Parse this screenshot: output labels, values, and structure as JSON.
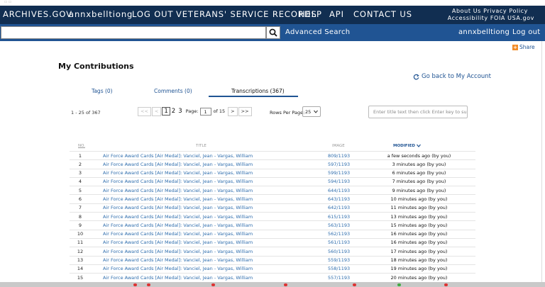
{
  "topnav": {
    "brand": "ARCHIVES.GOV",
    "username": "annxbelltiong",
    "logout": "LOG OUT",
    "veterans": "VETERANS' SERVICE RECORDS",
    "help": "HELP",
    "api": "API",
    "contact": "CONTACT US",
    "util_row1": "About Us  Privacy Policy",
    "util_row2": "Accessibility  FOIA  USA.gov"
  },
  "searchbar": {
    "query": "",
    "placeholder": "",
    "advanced": "Advanced Search",
    "username": "annxbelltiong",
    "logout": "Log out"
  },
  "share": "Share",
  "page_title": "My Contributions",
  "go_back": "Go back to My Account",
  "tabs": [
    {
      "label": "Tags (0)"
    },
    {
      "label": "Comments (0)"
    },
    {
      "label": "Transcriptions (367)"
    }
  ],
  "pagination": {
    "range": "1 - 25 of 367",
    "first": "<<",
    "prev": "<",
    "pages": [
      "1",
      "2",
      "3"
    ],
    "page_label": "Page:",
    "page_value": "1",
    "of": "of 15",
    "next": ">",
    "last": ">>"
  },
  "rows_per_page": {
    "label": "Rows Per Page:",
    "value": "25"
  },
  "filter": {
    "placeholder": "Enter title text then click Enter key to sub"
  },
  "table": {
    "headers": {
      "no": "NO.",
      "title": "TITLE",
      "image": "IMAGE",
      "modified": "MODIFIED"
    },
    "rows": [
      {
        "no": "1",
        "title": "Air Force Award Cards [Air Medal]: Vanciel, Jean - Vargas, William",
        "image": "809/1193",
        "modified": "a few seconds ago (by you)"
      },
      {
        "no": "2",
        "title": "Air Force Award Cards [Air Medal]: Vanciel, Jean - Vargas, William",
        "image": "597/1193",
        "modified": "3 minutes ago (by you)"
      },
      {
        "no": "3",
        "title": "Air Force Award Cards [Air Medal]: Vanciel, Jean - Vargas, William",
        "image": "599/1193",
        "modified": "6 minutes ago (by you)"
      },
      {
        "no": "4",
        "title": "Air Force Award Cards [Air Medal]: Vanciel, Jean - Vargas, William",
        "image": "594/1193",
        "modified": "7 minutes ago (by you)"
      },
      {
        "no": "5",
        "title": "Air Force Award Cards [Air Medal]: Vanciel, Jean - Vargas, William",
        "image": "644/1193",
        "modified": "9 minutes ago (by you)"
      },
      {
        "no": "6",
        "title": "Air Force Award Cards [Air Medal]: Vanciel, Jean - Vargas, William",
        "image": "643/1193",
        "modified": "10 minutes ago (by you)"
      },
      {
        "no": "7",
        "title": "Air Force Award Cards [Air Medal]: Vanciel, Jean - Vargas, William",
        "image": "642/1193",
        "modified": "11 minutes ago (by you)"
      },
      {
        "no": "8",
        "title": "Air Force Award Cards [Air Medal]: Vanciel, Jean - Vargas, William",
        "image": "615/1193",
        "modified": "13 minutes ago (by you)"
      },
      {
        "no": "9",
        "title": "Air Force Award Cards [Air Medal]: Vanciel, Jean - Vargas, William",
        "image": "563/1193",
        "modified": "15 minutes ago (by you)"
      },
      {
        "no": "10",
        "title": "Air Force Award Cards [Air Medal]: Vanciel, Jean - Vargas, William",
        "image": "562/1193",
        "modified": "16 minutes ago (by you)"
      },
      {
        "no": "11",
        "title": "Air Force Award Cards [Air Medal]: Vanciel, Jean - Vargas, William",
        "image": "561/1193",
        "modified": "16 minutes ago (by you)"
      },
      {
        "no": "12",
        "title": "Air Force Award Cards [Air Medal]: Vanciel, Jean - Vargas, William",
        "image": "560/1193",
        "modified": "17 minutes ago (by you)"
      },
      {
        "no": "13",
        "title": "Air Force Award Cards [Air Medal]: Vanciel, Jean - Vargas, William",
        "image": "559/1193",
        "modified": "18 minutes ago (by you)"
      },
      {
        "no": "14",
        "title": "Air Force Award Cards [Air Medal]: Vanciel, Jean - Vargas, William",
        "image": "558/1193",
        "modified": "19 minutes ago (by you)"
      },
      {
        "no": "15",
        "title": "Air Force Award Cards [Air Medal]: Vanciel, Jean - Vargas, William",
        "image": "557/1193",
        "modified": "20 minutes ago (by you)"
      }
    ]
  },
  "colors": {
    "nav_dark": "#112e51",
    "nav_blue": "#205493",
    "link": "#2e6dad",
    "share": "#f28c28"
  }
}
